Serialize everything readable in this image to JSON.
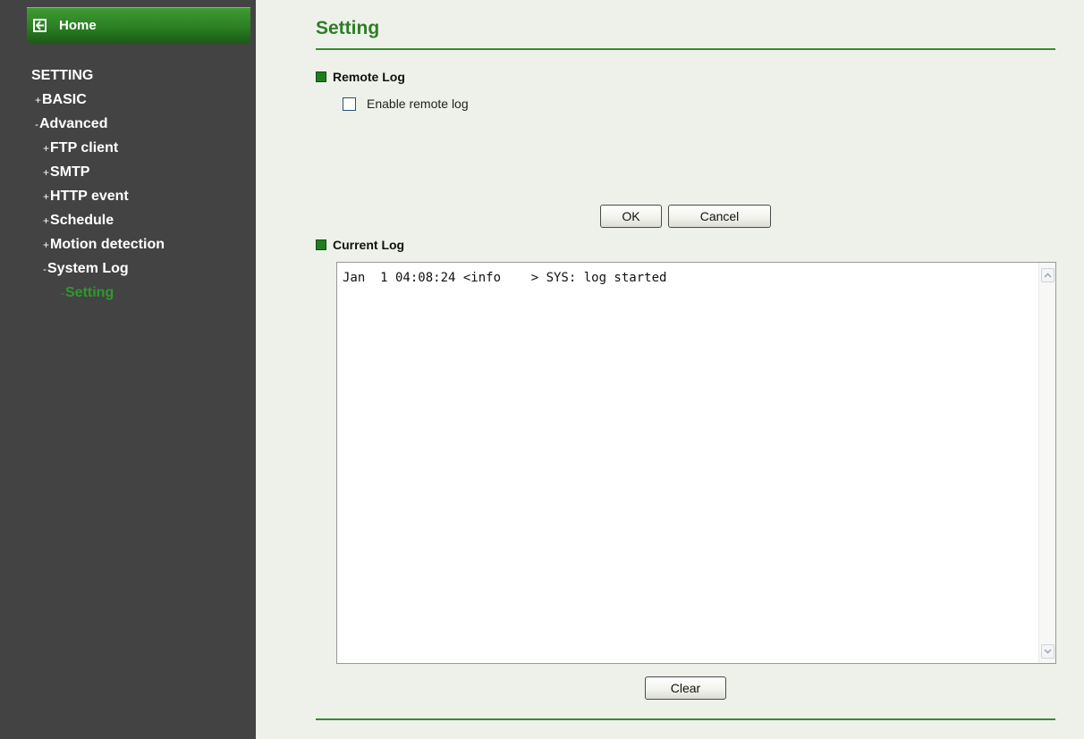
{
  "sidebar": {
    "home_label": "Home",
    "items": [
      {
        "mark": "",
        "label": "SETTING"
      },
      {
        "mark": "+",
        "label": "BASIC"
      },
      {
        "mark": "-",
        "label": "Advanced"
      },
      {
        "mark": "+",
        "label": "FTP client"
      },
      {
        "mark": "+",
        "label": "SMTP"
      },
      {
        "mark": "+",
        "label": "HTTP event"
      },
      {
        "mark": "+",
        "label": "Schedule"
      },
      {
        "mark": "+",
        "label": "Motion detection"
      },
      {
        "mark": "-",
        "label": "System Log"
      },
      {
        "mark": "-",
        "label": "Setting"
      }
    ]
  },
  "page": {
    "title": "Setting"
  },
  "remote_log": {
    "title": "Remote Log",
    "checkbox_label": "Enable remote log",
    "checked": false,
    "ok_label": "OK",
    "cancel_label": "Cancel"
  },
  "current_log": {
    "title": "Current Log",
    "text": "Jan  1 04:08:24 <info    > SYS: log started",
    "clear_label": "Clear"
  },
  "colors": {
    "sidebar_bg": "#434343",
    "accent_green": "#2e7d26",
    "active_item": "#2e9a2a",
    "main_bg": "#eef1ea"
  },
  "icons": {
    "home": "back-arrow-icon",
    "section_marker": "green-square-icon",
    "scroll_up": "chevron-up-icon",
    "scroll_down": "chevron-down-icon"
  }
}
